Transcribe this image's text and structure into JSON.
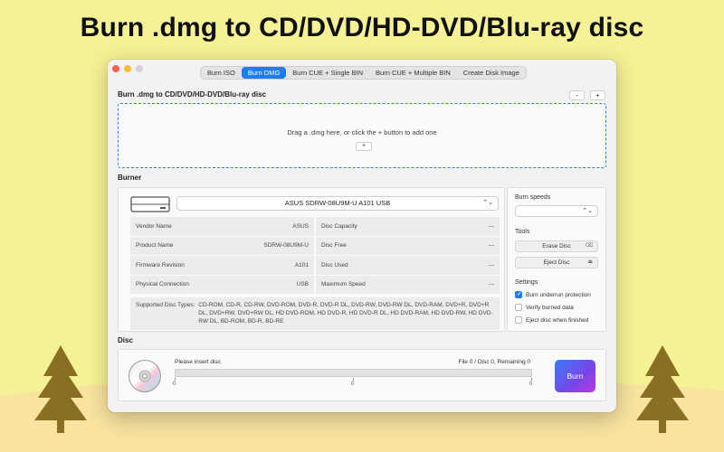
{
  "headline": "Burn .dmg to CD/DVD/HD-DVD/Blu-ray disc",
  "tabs": [
    {
      "label": "Burn ISO",
      "active": false
    },
    {
      "label": "Burn DMG",
      "active": true
    },
    {
      "label": "Burn CUE + Single BIN",
      "active": false
    },
    {
      "label": "Burn CUE + Multiple BIN",
      "active": false
    },
    {
      "label": "Create Disk Image",
      "active": false
    }
  ],
  "source": {
    "title": "Burn .dmg to CD/DVD/HD-DVD/Blu-ray disc",
    "remove_label": "-",
    "add_label": "+",
    "drop_text": "Drag a .dmg here, or click the + button to add one",
    "drop_add_label": "+"
  },
  "burner": {
    "title": "Burner",
    "device": "ASUS SDRW-08U9M-U A101 USB",
    "info": [
      {
        "label": "Vendor Name",
        "value": "ASUS"
      },
      {
        "label": "Disc Capacity",
        "value": "---"
      },
      {
        "label": "Product Name",
        "value": "SDRW-08U9M-U"
      },
      {
        "label": "Disc Free",
        "value": "---"
      },
      {
        "label": "Firmware Revision",
        "value": "A101"
      },
      {
        "label": "Disc Used",
        "value": "---"
      },
      {
        "label": "Physical Connection",
        "value": "USB"
      },
      {
        "label": "Maximum Speed",
        "value": "---"
      }
    ],
    "supported_label": "Supported Disc Types:",
    "supported_value": "CD-ROM, CD-R, CD-RW, DVD-ROM, DVD-R, DVD-R DL, DVD-RW, DVD-RW DL, DVD-RAM, DVD+R, DVD+R DL, DVD+RW, DVD+RW DL, HD DVD-ROM, HD DVD-R, HD DVD-R DL, HD DVD-RAM, HD DVD-RW, HD DVD-RW DL, BD-ROM, BD-R, BD-RE"
  },
  "side": {
    "speeds_label": "Burn speeds",
    "speed_value": "",
    "tools_label": "Tools",
    "erase_label": "Erase Disc",
    "eject_label": "Eject Disc",
    "settings_label": "Settings",
    "options": [
      {
        "label": "Burn underrun protection",
        "checked": true
      },
      {
        "label": "Verify burned data",
        "checked": false
      },
      {
        "label": "Eject disc when finished",
        "checked": false
      }
    ]
  },
  "disc": {
    "title": "Disc",
    "status": "Please insert disc",
    "counter": "File 0 / Disc 0, Remaining 0",
    "progress": 0,
    "ticks": [
      "0",
      "0",
      "0"
    ],
    "burn_label": "Burn"
  },
  "colors": {
    "background": "#f5f196",
    "hill": "#f8e39f",
    "tree": "#8a6f22",
    "accent": "#1f7cf2"
  }
}
